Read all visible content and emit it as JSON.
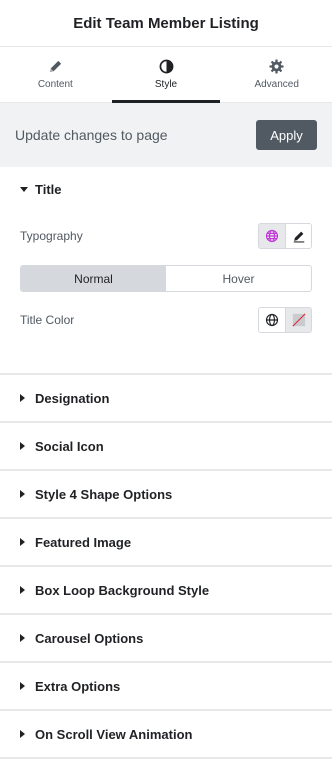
{
  "header": {
    "title": "Edit Team Member Listing"
  },
  "tabs": [
    {
      "label": "Content",
      "icon": "pencil-icon",
      "active": false
    },
    {
      "label": "Style",
      "icon": "contrast-icon",
      "active": true
    },
    {
      "label": "Advanced",
      "icon": "gear-icon",
      "active": false
    }
  ],
  "update_bar": {
    "text": "Update changes to page",
    "apply_label": "Apply"
  },
  "title_section": {
    "title": "Title",
    "typography_label": "Typography",
    "state_toggle": {
      "normal": "Normal",
      "hover": "Hover",
      "selected": "Normal"
    },
    "color_label": "Title Color"
  },
  "sections": [
    {
      "title": "Designation"
    },
    {
      "title": "Social Icon"
    },
    {
      "title": "Style 4 Shape Options"
    },
    {
      "title": "Featured Image"
    },
    {
      "title": "Box Loop Background Style"
    },
    {
      "title": "Carousel Options"
    },
    {
      "title": "Extra Options"
    },
    {
      "title": "On Scroll View Animation"
    }
  ],
  "colors": {
    "accent_globe": "#c036d6",
    "apply_bg": "#515962",
    "clear_slash": "#e0283a"
  }
}
